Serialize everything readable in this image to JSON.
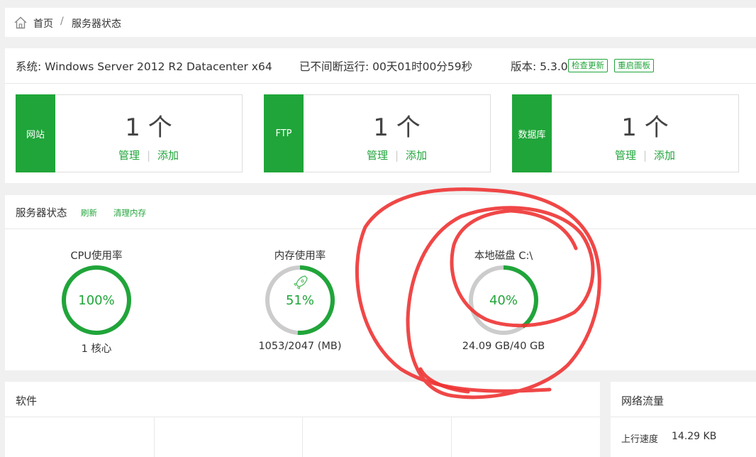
{
  "breadcrumb": {
    "home": "首页",
    "separator": "/",
    "current": "服务器状态"
  },
  "system": {
    "os_label": "系统:",
    "os_value": "Windows Server 2012 R2 Datacenter x64",
    "uptime_label": "已不间断运行:",
    "uptime_value": "00天01时00分59秒",
    "version_label": "版本:",
    "version_value": "5.3.0",
    "check_update": "检查更新",
    "restart_panel": "重启面板"
  },
  "cards": [
    {
      "tag": "网站",
      "count": "1 个",
      "manage": "管理",
      "add": "添加"
    },
    {
      "tag": "FTP",
      "count": "1 个",
      "manage": "管理",
      "add": "添加"
    },
    {
      "tag": "数据库",
      "count": "1 个",
      "manage": "管理",
      "add": "添加"
    }
  ],
  "status": {
    "title": "服务器状态",
    "refresh": "刷新",
    "clear_memory": "清理内存",
    "gauges": [
      {
        "label": "CPU使用率",
        "percent": 100,
        "value": "100%",
        "sub": "1 核心"
      },
      {
        "label": "内存使用率",
        "percent": 51,
        "value": "51%",
        "sub": "1053/2047 (MB)",
        "icon": "rocket-icon"
      },
      {
        "label": "本地磁盘 C:\\",
        "percent": 40,
        "value": "40%",
        "sub": "24.09 GB/40 GB"
      }
    ]
  },
  "software": {
    "title": "软件"
  },
  "network": {
    "title": "网络流量",
    "upload_label": "上行速度",
    "upload_value": "14.29 KB"
  },
  "colors": {
    "accent": "#20a53a",
    "track": "#cccccc",
    "annotation": "#ee3333"
  }
}
